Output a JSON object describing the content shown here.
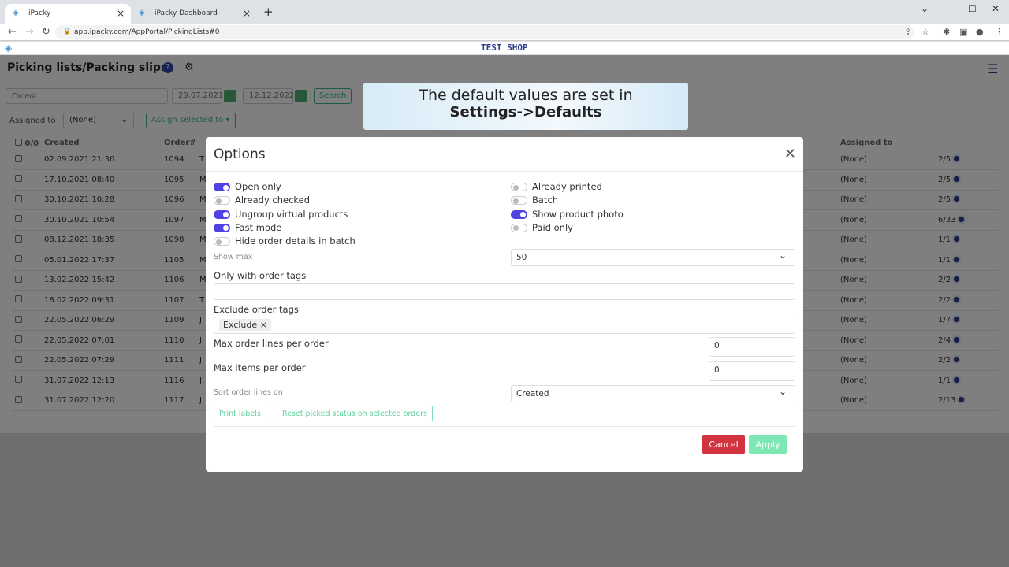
{
  "browser": {
    "tabs": [
      {
        "label": "iPacky"
      },
      {
        "label": "iPacky Dashboard"
      }
    ],
    "url": "app.ipacky.com/AppPortal/PickingLists#0"
  },
  "header": {
    "shop": "TEST SHOP",
    "title": "Picking lists/Packing slips"
  },
  "filters": {
    "order_placeholder": "Order#",
    "date_from": "29.07.2021",
    "date_to": "12.12.2022",
    "search_label": "Search",
    "assigned_label": "Assigned to",
    "assigned_value": "(None)",
    "assign_selected_label": "Assign selected to"
  },
  "table": {
    "headers": {
      "count": "0/0",
      "created": "Created",
      "order": "Order#",
      "assigned": "Assigned to"
    },
    "rows": [
      {
        "created": "02.09.2021 21:36",
        "order": "1094",
        "name": "T",
        "assigned": "(None)",
        "progress": "2/5"
      },
      {
        "created": "17.10.2021 08:40",
        "order": "1095",
        "name": "M",
        "assigned": "(None)",
        "progress": "2/5"
      },
      {
        "created": "30.10.2021 10:28",
        "order": "1096",
        "name": "M",
        "assigned": "(None)",
        "progress": "2/5"
      },
      {
        "created": "30.10.2021 10:54",
        "order": "1097",
        "name": "M",
        "assigned": "(None)",
        "progress": "6/33"
      },
      {
        "created": "08.12.2021 18:35",
        "order": "1098",
        "name": "M",
        "assigned": "(None)",
        "progress": "1/1"
      },
      {
        "created": "05.01.2022 17:37",
        "order": "1105",
        "name": "M",
        "assigned": "(None)",
        "progress": "1/1"
      },
      {
        "created": "13.02.2022 15:42",
        "order": "1106",
        "name": "M",
        "assigned": "(None)",
        "progress": "2/2"
      },
      {
        "created": "18.02.2022 09:31",
        "order": "1107",
        "name": "T",
        "assigned": "(None)",
        "progress": "2/2"
      },
      {
        "created": "22.05.2022 06:29",
        "order": "1109",
        "name": "J",
        "assigned": "(None)",
        "progress": "1/7"
      },
      {
        "created": "22.05.2022 07:01",
        "order": "1110",
        "name": "J",
        "assigned": "(None)",
        "progress": "2/4"
      },
      {
        "created": "22.05.2022 07:29",
        "order": "1111",
        "name": "J",
        "assigned": "(None)",
        "progress": "2/2"
      },
      {
        "created": "31.07.2022 12:13",
        "order": "1116",
        "name": "J",
        "assigned": "(None)",
        "progress": "1/1"
      },
      {
        "created": "31.07.2022 12:20",
        "order": "1117",
        "name": "J",
        "assigned": "(None)",
        "progress": "2/13"
      }
    ]
  },
  "banner": {
    "line1": "The default values are set in",
    "line2": "Settings->Defaults"
  },
  "modal": {
    "title": "Options",
    "toggles_left": [
      {
        "label": "Open only",
        "on": true
      },
      {
        "label": "Already checked",
        "on": false
      },
      {
        "label": "Ungroup virtual products",
        "on": true
      },
      {
        "label": "Fast mode",
        "on": true
      },
      {
        "label": "Hide order details in batch",
        "on": false
      }
    ],
    "toggles_right": [
      {
        "label": "Already printed",
        "on": false
      },
      {
        "label": "Batch",
        "on": false
      },
      {
        "label": "Show product photo",
        "on": true
      },
      {
        "label": "Paid only",
        "on": false
      }
    ],
    "show_max_label": "Show max",
    "show_max_value": "50",
    "only_tags_label": "Only with order tags",
    "only_tags_value": "",
    "exclude_tags_label": "Exclude order tags",
    "exclude_tag": "Exclude",
    "chip_remove": "×",
    "max_lines_label": "Max order lines per order",
    "max_lines_value": "0",
    "max_items_label": "Max items per order",
    "max_items_value": "0",
    "sort_label": "Sort order lines on",
    "sort_value": "Created",
    "print_labels": "Print labels",
    "reset_picked": "Reset picked status on selected orders",
    "cancel": "Cancel",
    "apply": "Apply"
  },
  "colors": {
    "accent": "#5142e6",
    "cancel": "#d1333f",
    "apply": "#7de8b4",
    "brand": "#2d3c8a"
  }
}
